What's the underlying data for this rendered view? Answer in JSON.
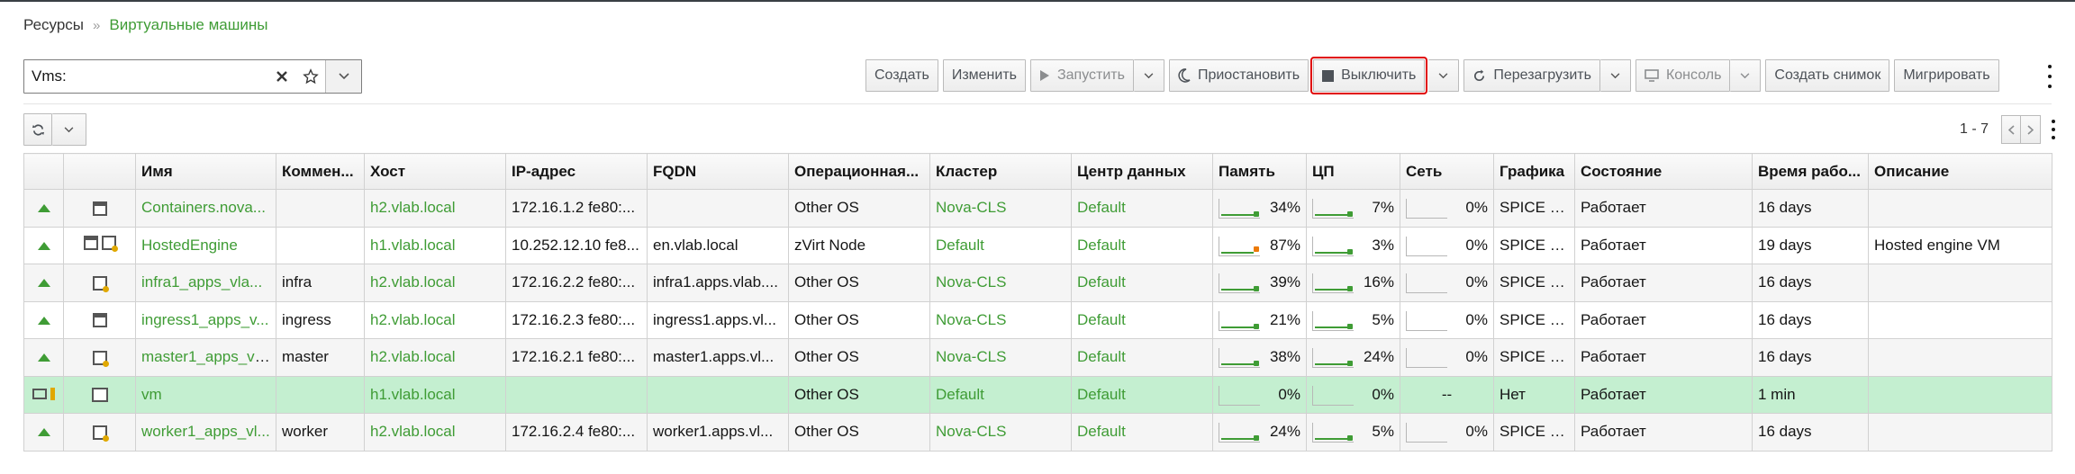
{
  "breadcrumb": {
    "root": "Ресурсы",
    "separator": "»",
    "current": "Виртуальные машины"
  },
  "search": {
    "value": "Vms:",
    "placeholder": ""
  },
  "toolbar": {
    "create": "Создать",
    "edit": "Изменить",
    "run": "Запустить",
    "suspend": "Приостановить",
    "shutdown": "Выключить",
    "reboot": "Перезагрузить",
    "console": "Консоль",
    "snapshot": "Создать снимок",
    "migrate": "Мигрировать"
  },
  "pager": {
    "count": "1 - 7"
  },
  "table": {
    "headers": [
      "",
      "",
      "Имя",
      "Коммен...",
      "Хост",
      "IP-адрес",
      "FQDN",
      "Операционная...",
      "Кластер",
      "Центр данных",
      "Память",
      "ЦП",
      "Сеть",
      "Графика",
      "Состояние",
      "Время рабо...",
      "Описание"
    ],
    "rows": [
      {
        "name": "Containers.nova...",
        "comment": "",
        "host": "h2.vlab.local",
        "ip": "172.16.1.2 fe80:...",
        "fqdn": "",
        "os": "Other OS",
        "cluster": "Nova-CLS",
        "dc": "Default",
        "mem": "34%",
        "mem_val": 34,
        "cpu": "7%",
        "cpu_val": 7,
        "net": "0%",
        "net_val": 0,
        "graphics": "SPICE + ...",
        "state": "Работает",
        "uptime": "16 days",
        "desc": ""
      },
      {
        "name": "HostedEngine",
        "comment": "",
        "host": "h1.vlab.local",
        "ip": "10.252.12.10 fe8...",
        "fqdn": "en.vlab.local",
        "os": "zVirt Node",
        "cluster": "Default",
        "dc": "Default",
        "mem": "87%",
        "mem_val": 87,
        "cpu": "3%",
        "cpu_val": 3,
        "net": "0%",
        "net_val": 0,
        "graphics": "SPICE + ...",
        "state": "Работает",
        "uptime": "19 days",
        "desc": "Hosted engine VM"
      },
      {
        "name": "infra1_apps_vla...",
        "comment": "infra",
        "host": "h2.vlab.local",
        "ip": "172.16.2.2 fe80:...",
        "fqdn": "infra1.apps.vlab....",
        "os": "Other OS",
        "cluster": "Nova-CLS",
        "dc": "Default",
        "mem": "39%",
        "mem_val": 39,
        "cpu": "16%",
        "cpu_val": 16,
        "net": "0%",
        "net_val": 0,
        "graphics": "SPICE + ...",
        "state": "Работает",
        "uptime": "16 days",
        "desc": ""
      },
      {
        "name": "ingress1_apps_v...",
        "comment": "ingress",
        "host": "h2.vlab.local",
        "ip": "172.16.2.3 fe80:...",
        "fqdn": "ingress1.apps.vl...",
        "os": "Other OS",
        "cluster": "Nova-CLS",
        "dc": "Default",
        "mem": "21%",
        "mem_val": 21,
        "cpu": "5%",
        "cpu_val": 5,
        "net": "0%",
        "net_val": 0,
        "graphics": "SPICE + ...",
        "state": "Работает",
        "uptime": "16 days",
        "desc": ""
      },
      {
        "name": "master1_apps_vl...",
        "comment": "master",
        "host": "h2.vlab.local",
        "ip": "172.16.2.1 fe80:...",
        "fqdn": "master1.apps.vl...",
        "os": "Other OS",
        "cluster": "Nova-CLS",
        "dc": "Default",
        "mem": "38%",
        "mem_val": 38,
        "cpu": "24%",
        "cpu_val": 24,
        "net": "0%",
        "net_val": 0,
        "graphics": "SPICE + ...",
        "state": "Работает",
        "uptime": "16 days",
        "desc": ""
      },
      {
        "name": "vm",
        "comment": "",
        "host": "h1.vlab.local",
        "ip": "",
        "fqdn": "",
        "os": "Other OS",
        "cluster": "Default",
        "dc": "Default",
        "mem": "0%",
        "mem_val": 0,
        "cpu": "0%",
        "cpu_val": 0,
        "net": "--",
        "net_val": 0,
        "graphics": "Нет",
        "state": "Работает",
        "uptime": "1 min",
        "desc": ""
      },
      {
        "name": "worker1_apps_vl...",
        "comment": "worker",
        "host": "h2.vlab.local",
        "ip": "172.16.2.4 fe80:...",
        "fqdn": "worker1.apps.vl...",
        "os": "Other OS",
        "cluster": "Nova-CLS",
        "dc": "Default",
        "mem": "24%",
        "mem_val": 24,
        "cpu": "5%",
        "cpu_val": 5,
        "net": "0%",
        "net_val": 0,
        "graphics": "SPICE + ...",
        "state": "Работает",
        "uptime": "16 days",
        "desc": ""
      }
    ]
  },
  "icons": {
    "clear": "close-icon",
    "favorite": "star-icon",
    "refresh": "refresh-icon",
    "status_up": "arrow-up-icon"
  },
  "colors": {
    "link": "#3f9c35",
    "selected_row": "#c4efd0",
    "highlight": "#e00000",
    "warn": "#ec7a08"
  }
}
